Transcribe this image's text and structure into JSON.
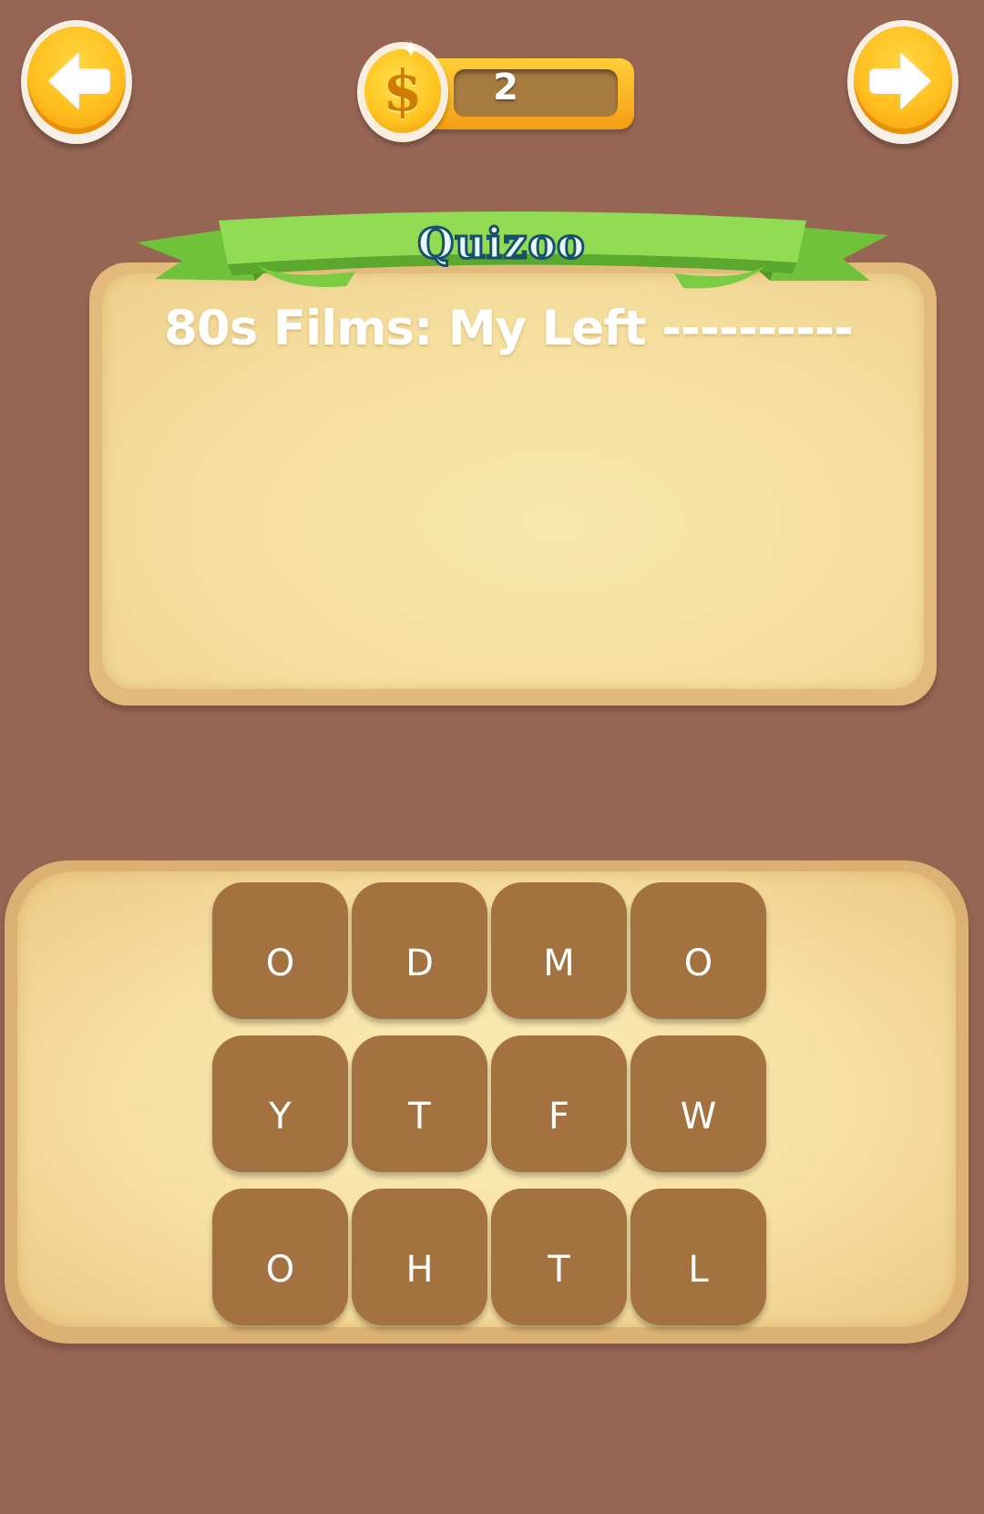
{
  "header": {
    "back_icon": "arrow-left-icon",
    "next_icon": "arrow-right-icon",
    "coin_icon": "dollar-coin-icon",
    "coin_symbol": "$",
    "coins": "2"
  },
  "banner": {
    "title": "Quizoo"
  },
  "question": {
    "text": "80s Films: My Left ----------"
  },
  "letters": [
    "O",
    "D",
    "M",
    "O",
    "Y",
    "T",
    "F",
    "W",
    "O",
    "H",
    "T",
    "L"
  ],
  "colors": {
    "background": "#976554",
    "tile": "#a37240",
    "accent": "#ffbf1e",
    "ribbon": "#8fd94e"
  }
}
